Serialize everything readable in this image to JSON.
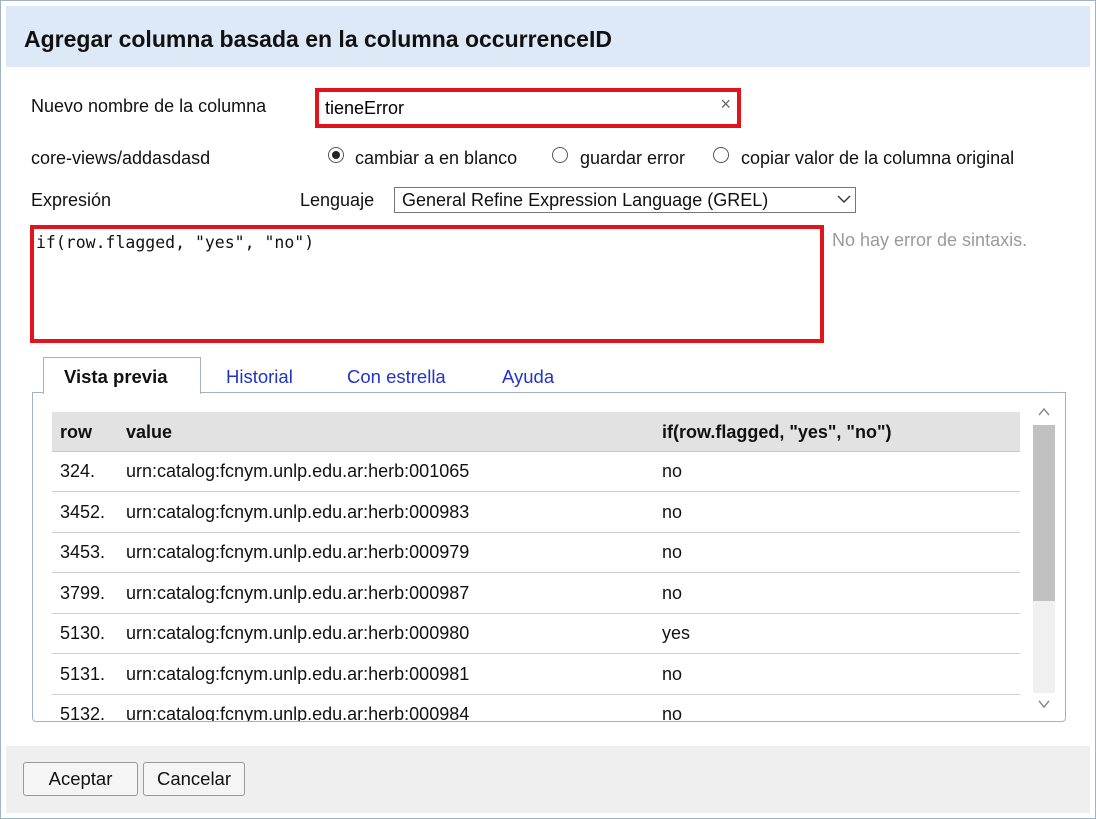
{
  "dialog": {
    "title": "Agregar columna basada en la columna occurrenceID"
  },
  "form": {
    "new_column_label": "Nuevo nombre de la columna",
    "new_column_value": "tieneError",
    "clear_symbol": "×",
    "error_label": "core-views/addasdasd",
    "on_error_options": [
      {
        "label": "cambiar a en blanco",
        "selected": true
      },
      {
        "label": "guardar error",
        "selected": false
      },
      {
        "label": "copiar valor de la columna original",
        "selected": false
      }
    ],
    "expression_label": "Expresión",
    "language_label": "Lenguaje",
    "language_value": "General Refine Expression Language (GREL)",
    "expression": "if(row.flagged, \"yes\", \"no\")",
    "syntax_status": "No hay error de sintaxis."
  },
  "tabs": [
    {
      "label": "Vista previa",
      "active": true
    },
    {
      "label": "Historial",
      "active": false
    },
    {
      "label": "Con estrella",
      "active": false
    },
    {
      "label": "Ayuda",
      "active": false
    }
  ],
  "preview_table": {
    "headers": [
      "row",
      "value",
      "if(row.flagged, \"yes\", \"no\")"
    ],
    "rows": [
      [
        "324.",
        "urn:catalog:fcnym.unlp.edu.ar:herb:001065",
        "no"
      ],
      [
        "3452.",
        "urn:catalog:fcnym.unlp.edu.ar:herb:000983",
        "no"
      ],
      [
        "3453.",
        "urn:catalog:fcnym.unlp.edu.ar:herb:000979",
        "no"
      ],
      [
        "3799.",
        "urn:catalog:fcnym.unlp.edu.ar:herb:000987",
        "no"
      ],
      [
        "5130.",
        "urn:catalog:fcnym.unlp.edu.ar:herb:000980",
        "yes"
      ],
      [
        "5131.",
        "urn:catalog:fcnym.unlp.edu.ar:herb:000981",
        "no"
      ],
      [
        "5132.",
        "urn:catalog:fcnym.unlp.edu.ar:herb:000984",
        "no"
      ]
    ]
  },
  "buttons": {
    "ok": "Aceptar",
    "cancel": "Cancelar"
  },
  "colors": {
    "highlight_border": "#e2131b",
    "header_bg": "#dde9f7",
    "tab_link": "#2233cc"
  }
}
